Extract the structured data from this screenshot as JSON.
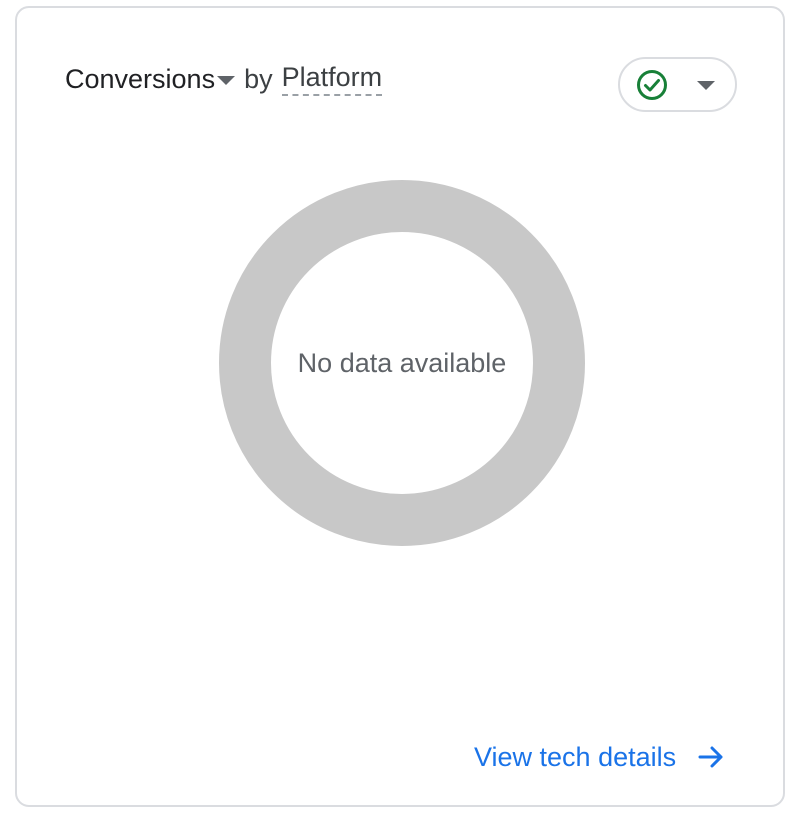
{
  "card": {
    "title": {
      "metric": "Conversions",
      "connector": "by",
      "dimension": "Platform"
    },
    "status_dropdown": {
      "icon": "check-circle-icon",
      "icon_color": "#188038",
      "caret": "caret-down-icon"
    },
    "chart": {
      "empty_message": "No data available",
      "ring_color": "#c8c8c8"
    },
    "footer": {
      "link_label": "View tech details",
      "link_icon": "arrow-right-icon",
      "link_color": "#1a73e8"
    }
  }
}
